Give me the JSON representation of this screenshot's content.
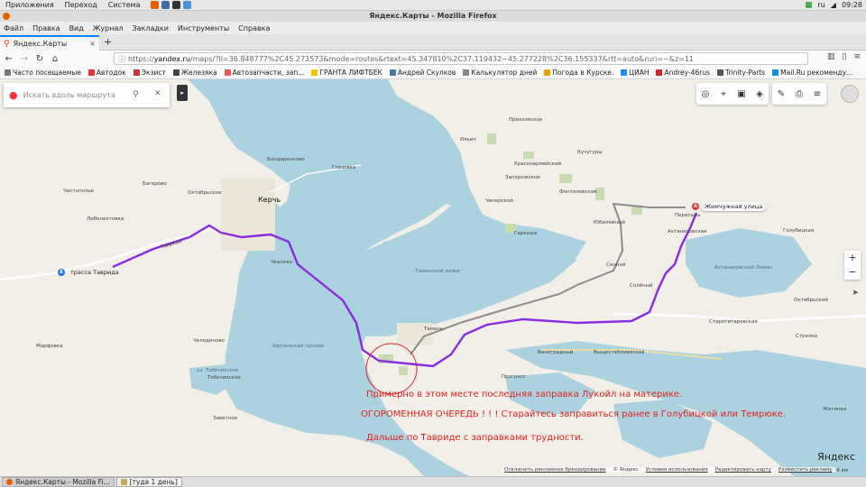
{
  "system": {
    "menu": [
      "Приложения",
      "Переход",
      "Система"
    ],
    "lang": "ru",
    "time": "09:28"
  },
  "window": {
    "title": "Яндекс.Карты - Mozilla Firefox"
  },
  "menubar": [
    "Файл",
    "Правка",
    "Вид",
    "Журнал",
    "Закладки",
    "Инструменты",
    "Справка"
  ],
  "tab": {
    "title": "Яндекс.Карты",
    "close": "×",
    "new": "+"
  },
  "nav": {
    "url_scheme": "https://",
    "url_host": "yandex.ru",
    "url_rest": "/maps/?ll=36.848777%2C45.273573&mode=routes&rtext=45.347810%2C37.119432~45.277228%2C36.155337&rtt=auto&ruri=~&z=11"
  },
  "bookmarks": [
    {
      "label": "Часто посещаемые",
      "color": "#777"
    },
    {
      "label": "Автодок",
      "color": "#e33"
    },
    {
      "label": "Экзист",
      "color": "#c33"
    },
    {
      "label": "Железяка",
      "color": "#444"
    },
    {
      "label": "Автозапчасти, зап...",
      "color": "#e55"
    },
    {
      "label": "ГРАНТА ЛИФТБЕК",
      "color": "#f4c400"
    },
    {
      "label": "Андрей Скулков",
      "color": "#4a76a8"
    },
    {
      "label": "Калькулятор дней",
      "color": "#888"
    },
    {
      "label": "Погода в Курске.",
      "color": "#f0a000"
    },
    {
      "label": "ЦИАН",
      "color": "#1a8cff"
    },
    {
      "label": "Andrey-46rus",
      "color": "#d22"
    },
    {
      "label": "Trinity-Parts",
      "color": "#555"
    },
    {
      "label": "Mail.Ru рекоменду...",
      "color": "#168de2"
    }
  ],
  "map": {
    "search_placeholder": "Искать вдоль маршрута",
    "route_start": {
      "letter": "Б",
      "label": "трасса Таврида"
    },
    "route_end": {
      "letter": "А",
      "label": "Жемчужная улица"
    },
    "cities": [
      {
        "name": "Керчь"
      }
    ],
    "places": [
      "Приазовское",
      "Ильич",
      "Кучугуры",
      "Красноармейский",
      "Запорожское",
      "Фонталовская",
      "Чеперской",
      "Гаркуша",
      "Юбилейный",
      "Пересыпь",
      "Ахтанизовская",
      "Голубицкая",
      "Тамань",
      "Сенной",
      "Солёный",
      "Стаpотитаровская",
      "Виноградный",
      "Выщестеблиевская",
      "Прогресс",
      "Стрелка",
      "Октябрьский",
      "Жигинка",
      "Бондаренково",
      "Глазовка",
      "Багерово",
      "Октябрьское",
      "Чистополье",
      "Либкнехтовка",
      "Марфовка",
      "Челядиново",
      "Заветное",
      "Тобечикское",
      "Чкалово"
    ],
    "water_labels": [
      "Таманский залив",
      "Керченский пролив",
      "Ахтанизовский Лиман",
      "оз. Тобечикское"
    ],
    "road_label": "Таврида",
    "annotations": [
      "Примерно в этом месте последняя заправка Лукойл на материке.",
      "ОГОРОМЕННАЯ ОЧЕРЕДЬ ! ! ! Старайтесь заправиться ранее в Голубицкой или Темрюке.",
      "Дальше по Тавриде с заправками трудности."
    ],
    "footer": {
      "ad": "Отключить рекламное брендирование",
      "copyright": "© Яндекс",
      "terms": "Условия использования",
      "edit": "Редактировать карту",
      "ads": "Разместить рекламу",
      "scale": "4 км"
    },
    "logo": "Яндекс"
  },
  "taskbar": [
    {
      "label": "Яндекс.Карты - Mozilla Fi...",
      "active": true
    },
    {
      "label": "[туда 1 день]",
      "active": false
    }
  ],
  "colors": {
    "route": "#8a2be2",
    "route_alt": "#8c8c8c",
    "annotation": "#e62020",
    "land": "#f2efe9",
    "water": "#aad3df"
  }
}
